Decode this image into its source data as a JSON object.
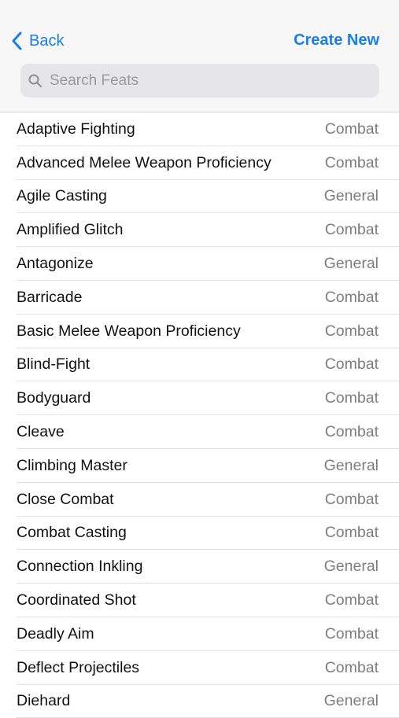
{
  "nav": {
    "back_label": "Back",
    "create_label": "Create New"
  },
  "search": {
    "placeholder": "Search Feats",
    "value": ""
  },
  "colors": {
    "accent": "#1a7ee6",
    "secondary_text": "#7d7d80",
    "search_bg": "#e6e6e8",
    "header_bg": "#f7f7f7"
  },
  "icons": {
    "back": "chevron-left-icon",
    "search": "search-icon"
  },
  "feats": [
    {
      "name": "Adaptive Fighting",
      "type": "Combat"
    },
    {
      "name": "Advanced Melee Weapon Proficiency",
      "type": "Combat"
    },
    {
      "name": "Agile Casting",
      "type": "General"
    },
    {
      "name": "Amplified Glitch",
      "type": "Combat"
    },
    {
      "name": "Antagonize",
      "type": "General"
    },
    {
      "name": "Barricade",
      "type": "Combat"
    },
    {
      "name": "Basic Melee Weapon Proficiency",
      "type": "Combat"
    },
    {
      "name": "Blind-Fight",
      "type": "Combat"
    },
    {
      "name": "Bodyguard",
      "type": "Combat"
    },
    {
      "name": "Cleave",
      "type": "Combat"
    },
    {
      "name": "Climbing Master",
      "type": "General"
    },
    {
      "name": "Close Combat",
      "type": "Combat"
    },
    {
      "name": "Combat Casting",
      "type": "Combat"
    },
    {
      "name": "Connection Inkling",
      "type": "General"
    },
    {
      "name": "Coordinated Shot",
      "type": "Combat"
    },
    {
      "name": "Deadly Aim",
      "type": "Combat"
    },
    {
      "name": "Deflect Projectiles",
      "type": "Combat"
    },
    {
      "name": "Diehard",
      "type": "General"
    }
  ]
}
